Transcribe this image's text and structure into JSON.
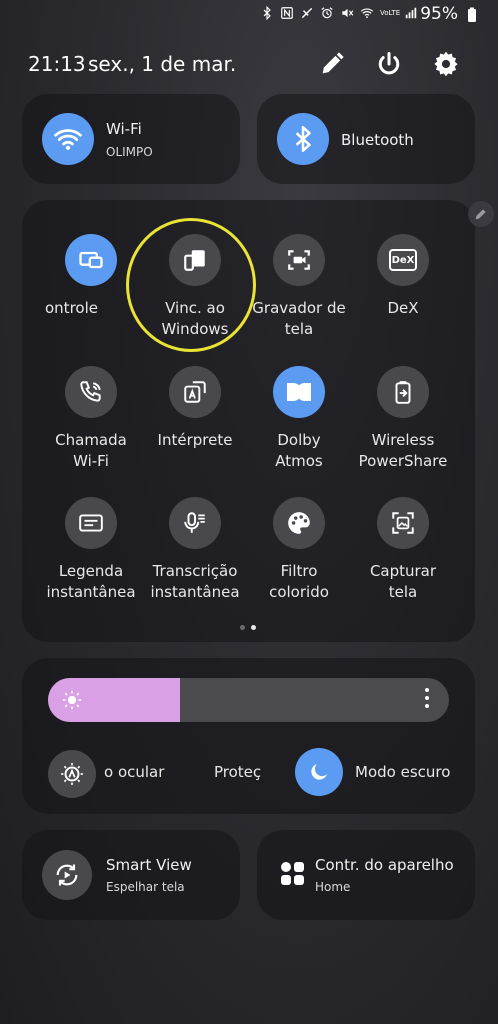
{
  "status": {
    "battery": "95%",
    "icons": [
      "bluetooth-icon",
      "nfc-icon",
      "no-disturb-icon",
      "alarm-icon",
      "mute-icon",
      "wifi-icon",
      "volte-icon",
      "signal-icon",
      "battery-icon"
    ],
    "volte_label": "VoLTE"
  },
  "header": {
    "time": "21:13",
    "date": "sex., 1 de mar."
  },
  "wifi": {
    "title": "Wi-Fi",
    "subtitle": "OLIMPO"
  },
  "bluetooth": {
    "title": "Bluetooth"
  },
  "tiles": [
    {
      "label": "ontrole",
      "icon": "controls-icon",
      "active": true
    },
    {
      "label": "Vinc. ao\nWindows",
      "icon": "link-windows-icon",
      "active": false
    },
    {
      "label": "Gravador de\ntela",
      "icon": "screen-recorder-icon",
      "active": false
    },
    {
      "label": "DeX",
      "icon": "dex-icon",
      "active": false,
      "badge": "DeX"
    },
    {
      "label": "Chamada\nWi-Fi",
      "icon": "wifi-call-icon",
      "active": false
    },
    {
      "label": "Intérprete",
      "icon": "interpreter-icon",
      "active": false
    },
    {
      "label": "Dolby\nAtmos",
      "icon": "dolby-icon",
      "active": true
    },
    {
      "label": "Wireless\nPowerShare",
      "icon": "powershare-icon",
      "active": false
    },
    {
      "label": "Legenda\ninstantânea",
      "icon": "caption-icon",
      "active": false
    },
    {
      "label": "Transcrição\ninstantânea",
      "icon": "transcribe-icon",
      "active": false
    },
    {
      "label": "Filtro\ncolorido",
      "icon": "palette-icon",
      "active": false
    },
    {
      "label": "Capturar\ntela",
      "icon": "screenshot-icon",
      "active": false
    }
  ],
  "pager": {
    "pages": 2,
    "current": 1
  },
  "brightness": {
    "level": 0.33
  },
  "toggles": {
    "eye": "o ocular",
    "protect": "Proteç",
    "dark_mode": "Modo escuro"
  },
  "smart_view": {
    "title": "Smart View",
    "subtitle": "Espelhar tela"
  },
  "device": {
    "title": "Contr. do aparelho",
    "subtitle": "Home"
  },
  "colors": {
    "accent": "#5b9cf2",
    "brightness": "#d9a0e6",
    "highlight": "#e8e334"
  }
}
